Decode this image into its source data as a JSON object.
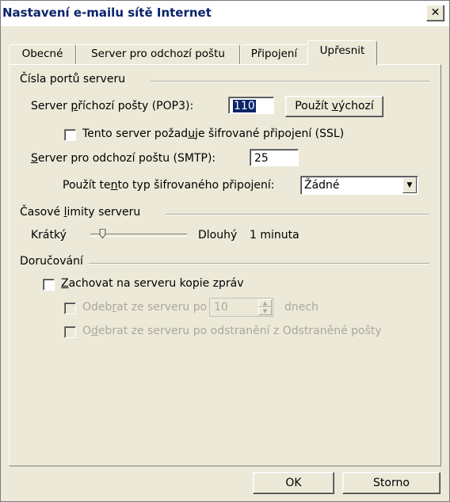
{
  "window": {
    "title": "Nastavení e-mailu sítě Internet",
    "close_label": "✕"
  },
  "tabs": [
    {
      "label": "Obecné",
      "active": false
    },
    {
      "label": "Server pro odchozí poštu",
      "active": false
    },
    {
      "label": "Připojení",
      "active": false
    },
    {
      "label": "Upřesnit",
      "active": true
    }
  ],
  "ports_group": {
    "title": "Čísla portů serveru",
    "pop3_label_pre": "Server ",
    "pop3_label_acc": "p",
    "pop3_label_post": "říchozí pošty (POP3):",
    "pop3_value": "110",
    "use_default_pre": "Použít ",
    "use_default_acc": "v",
    "use_default_post": "ýchozí",
    "ssl_pre": "Tento server požad",
    "ssl_acc": "u",
    "ssl_post": "je šifrované připojení (SSL)",
    "ssl_checked": false,
    "smtp_label_acc": "S",
    "smtp_label_post": "erver pro odchozí poštu (SMTP):",
    "smtp_value": "25",
    "enc_pre": "Použít te",
    "enc_acc": "n",
    "enc_post": "to typ šifrovaného připojení:",
    "enc_value": "Žádné"
  },
  "timeouts_group": {
    "title_pre": "Časové ",
    "title_acc": "l",
    "title_post": "imity serveru",
    "short_label": "Krátký",
    "long_label": "Dlouhý",
    "timeout_value": "1 minuta",
    "slider_level": 0.1
  },
  "delivery_group": {
    "title": "Doručování",
    "keep_acc": "Z",
    "keep_post": "achovat na serveru kopie zpráv",
    "keep_checked": false,
    "remove_after_pre": "Odeb",
    "remove_after_acc": "r",
    "remove_after_post": "at ze serveru po",
    "remove_after_days": "10",
    "days_unit": "dnech",
    "remove_deleted_pre": "O",
    "remove_deleted_acc": "d",
    "remove_deleted_post": "ebrat ze serveru po odstranění z Odstraněné pošty"
  },
  "footer": {
    "ok_label": "OK",
    "cancel_label": "Storno"
  }
}
